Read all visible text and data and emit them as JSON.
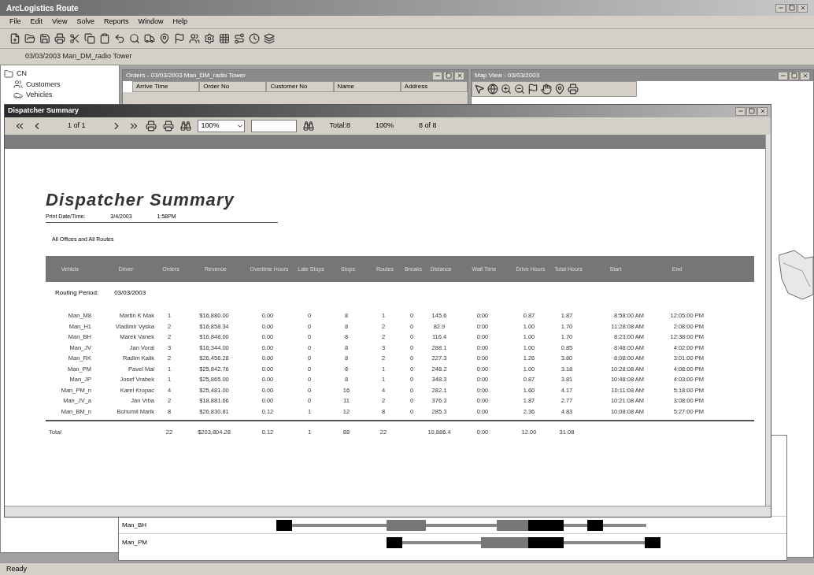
{
  "app": {
    "title": "ArcLogistics Route"
  },
  "menu": [
    "File",
    "Edit",
    "View",
    "Solve",
    "Reports",
    "Window",
    "Help"
  ],
  "route_label": "03/03/2003 Man_DM_radio Tower",
  "tree": [
    {
      "label": "CN",
      "children": [
        {
          "label": "Customers"
        },
        {
          "label": "Vehicles"
        }
      ]
    }
  ],
  "orders_window": {
    "title": "Orders - 03/03/2003 Man_DM_radio Tower",
    "columns": [
      "Arrive Time",
      "Order No",
      "Customer No",
      "Name",
      "Address"
    ]
  },
  "map_window": {
    "title": "Map View - 03/03/2003"
  },
  "report_window": {
    "title": "Dispatcher Summary",
    "page": "1 of 1",
    "zoom": "100%",
    "total": "Total:8",
    "percent": "100%",
    "count": "8 of 8"
  },
  "report": {
    "title": "Dispatcher Summary",
    "print_label": "Print Date/Time:",
    "print_date": "3/4/2003",
    "print_time": "1:58PM",
    "scope": "All Offices and All Routes",
    "columns": [
      "Vehicle",
      "Driver",
      "Orders",
      "Revenue",
      "Overtime Hours",
      "Late Stops",
      "Stops",
      "Routes",
      "Breaks",
      "Distance",
      "Wait Time",
      "Drive Hours",
      "Total Hours",
      "Start",
      "End"
    ],
    "period_label": "Routing Period:",
    "period": "03/03/2003",
    "rows": [
      [
        "Man_M8",
        "Martin K Mak",
        "1",
        "$16,880.00",
        "0.00",
        "0",
        "8",
        "1",
        "0",
        "145.6",
        "0:00",
        "0.87",
        "1.87",
        "8:58:00 AM",
        "12:05:00 PM"
      ],
      [
        "Man_H1",
        "Vladimir Vyska",
        "2",
        "$16,858.34",
        "0.00",
        "0",
        "8",
        "2",
        "0",
        "82.9",
        "0:00",
        "1.00",
        "1.70",
        "11:28:08 AM",
        "2:08:00 PM"
      ],
      [
        "Man_BH",
        "Marek Vanek",
        "2",
        "$16,848.00",
        "0.00",
        "0",
        "8",
        "2",
        "0",
        "116.4",
        "0:00",
        "1.00",
        "1.70",
        "8:23:00 AM",
        "12:38:00 PM"
      ],
      [
        "Man_JV",
        "Jan Voral",
        "3",
        "$16,344.00",
        "0.00",
        "0",
        "8",
        "3",
        "0",
        "288.1",
        "0:00",
        "1.00",
        "0.85",
        "8:48:00 AM",
        "4:02:00 PM"
      ],
      [
        "Man_RK",
        "Radim Kalik",
        "2",
        "$26,456.28",
        "0.00",
        "0",
        "8",
        "2",
        "0",
        "227.3",
        "0:00",
        "1.26",
        "3.80",
        "8:08:00 AM",
        "3:01:00 PM"
      ],
      [
        "Man_PM",
        "Pavel Mal",
        "1",
        "$25,842.76",
        "0.00",
        "0",
        "8",
        "1",
        "0",
        "248.2",
        "0:00",
        "1.00",
        "3.18",
        "10:28:08 AM",
        "4:08:00 PM"
      ],
      [
        "Man_JP",
        "Josef Vrabek",
        "1",
        "$25,865.00",
        "0.00",
        "0",
        "8",
        "1",
        "0",
        "348.3",
        "0:00",
        "0.87",
        "3.81",
        "10:48:08 AM",
        "4:03:00 PM"
      ],
      [
        "Man_PM_n",
        "Karel Kropac",
        "4",
        "$25,481.00",
        "0.00",
        "0",
        "16",
        "4",
        "0",
        "282.1",
        "0:00",
        "1.60",
        "4.17",
        "10:11:08 AM",
        "5:18:00 PM"
      ],
      [
        "Man_JV_a",
        "Jan Vrba",
        "2",
        "$18,881.66",
        "0.00",
        "0",
        "11",
        "2",
        "0",
        "376.3",
        "0:00",
        "1.87",
        "2.77",
        "10:21:08 AM",
        "3:08:00 PM"
      ],
      [
        "Man_BM_n",
        "Bohumil Marik",
        "8",
        "$26,830.81",
        "0.12",
        "1",
        "12",
        "8",
        "0",
        "285.3",
        "0:00",
        "2.36",
        "4.83",
        "10:08:08 AM",
        "5:27:00 PM"
      ]
    ],
    "total": {
      "label": "Total",
      "orders": "22",
      "revenue": "$203,804.28",
      "overtime_hours": "0.12",
      "late_stops": "1",
      "stops": "88",
      "routes": "22",
      "distance": "10,886.4",
      "wait_time": "0:00",
      "drive_hours": "12.00",
      "total_hours": "31.08"
    }
  },
  "gantt": [
    {
      "label": "Man_BH"
    },
    {
      "label": "Man_PM"
    }
  ],
  "status": "Ready"
}
